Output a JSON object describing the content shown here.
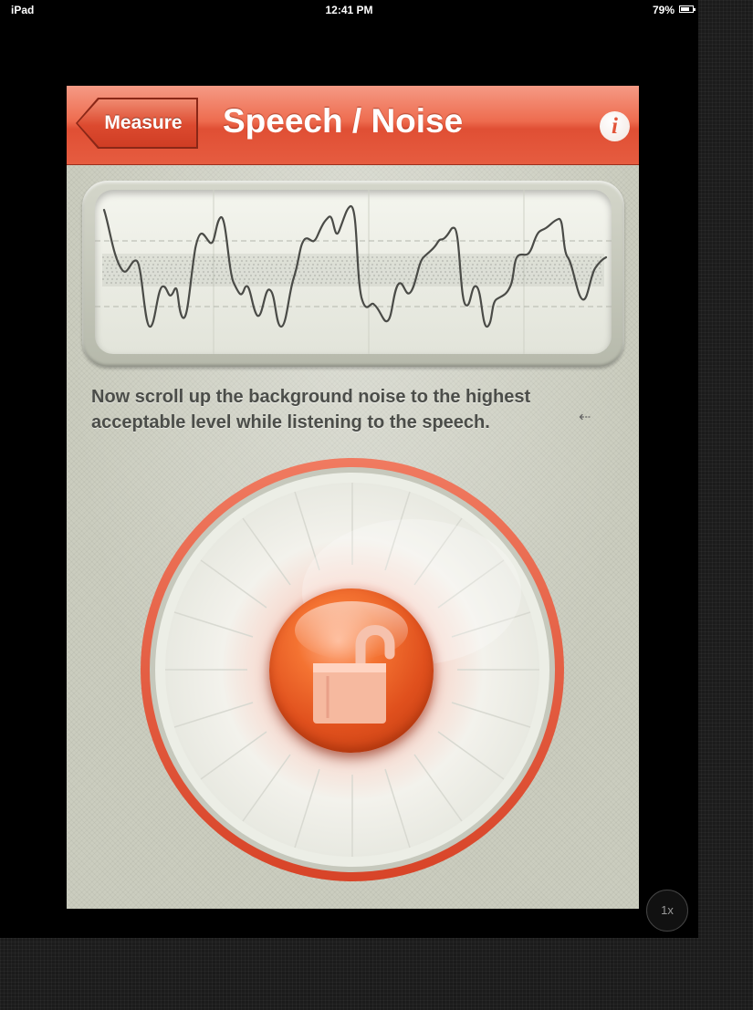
{
  "status_bar": {
    "device": "iPad",
    "time": "12:41 PM",
    "battery": "79%"
  },
  "nav": {
    "back_label": "Measure",
    "title": "Speech / Noise",
    "info_icon": "i"
  },
  "instruction": "Now scroll up the background noise to the highest acceptable level while listening to the speech.",
  "icons": {
    "scroll_hint": "⇠"
  },
  "speed_button": "1x",
  "colors": {
    "accent": "#e95a3e",
    "lock": "#e35a22"
  }
}
